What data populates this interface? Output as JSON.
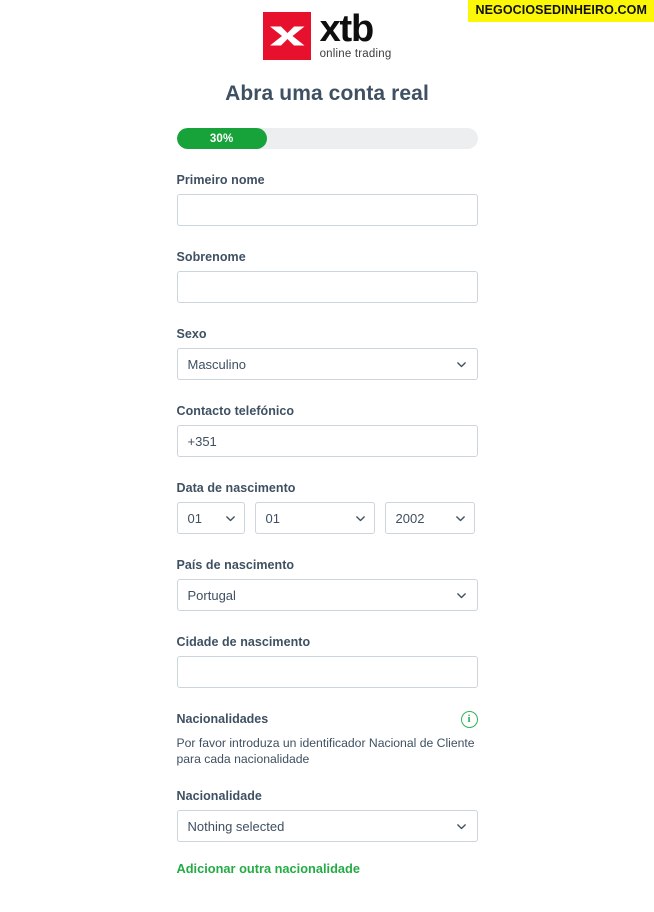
{
  "watermark": {
    "text": "NEGOCIOSEDINHEIRO.COM"
  },
  "brand": {
    "mark_icon": "xtb-x-mark-icon",
    "wordmark": "xtb",
    "tagline": "online trading",
    "mark_color": "#e8112d"
  },
  "header": {
    "title": "Abra uma conta real"
  },
  "progress": {
    "percent_label": "30%",
    "percent_value": 30,
    "fill_color": "#17a33a",
    "track_color": "#eceef0"
  },
  "form": {
    "first_name": {
      "label": "Primeiro nome",
      "value": "",
      "placeholder": ""
    },
    "last_name": {
      "label": "Sobrenome",
      "value": "",
      "placeholder": ""
    },
    "gender": {
      "label": "Sexo",
      "value": "Masculino"
    },
    "phone": {
      "label": "Contacto telefónico",
      "value": "+351",
      "placeholder": ""
    },
    "birth_date": {
      "label": "Data de nascimento",
      "day": "01",
      "month": "01",
      "year": "2002"
    },
    "birth_country": {
      "label": "País de nascimento",
      "value": "Portugal"
    },
    "birth_city": {
      "label": "Cidade de nascimento",
      "value": "",
      "placeholder": ""
    },
    "nationalities": {
      "title": "Nacionalidades",
      "info_icon": "info-circle-icon",
      "help_text": "Por favor introduza un identificador Nacional de Cliente para cada nacionalidade",
      "nationality_label": "Nacionalidade",
      "nationality_value": "Nothing selected",
      "add_link": "Adicionar outra nacionalidade",
      "link_color": "#25ab46"
    }
  },
  "icons": {
    "chevron_down": "chevron-down-icon"
  }
}
